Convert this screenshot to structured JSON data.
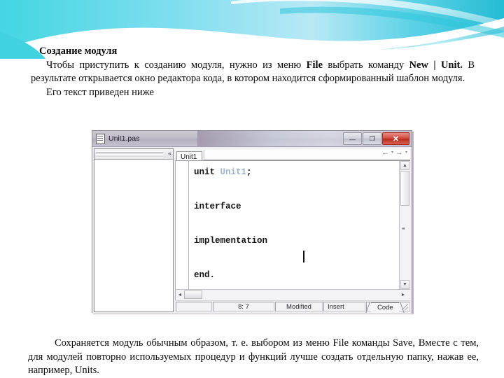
{
  "slide": {
    "heading": "Создание модуля",
    "paragraph_1_line1": "Чтобы приступить к созданию модуля, нужно из меню ",
    "paragraph_1_bold_file": "File",
    "paragraph_1_line1b": " выбрать команду ",
    "paragraph_1_bold_new": "New | Unit.",
    "paragraph_1_rest": " В результате открывается окно редактора кода, в котором находится сформированный шаблон модуля.",
    "paragraph_2": "Его текст приведен ниже",
    "paragraph_bottom_a": "Сохраняется модуль обычным образом, т. е. выбором из меню ",
    "paragraph_bottom_file": "File",
    "paragraph_bottom_b": " команды Save, Вместе с тем, для модулей повторно используемых процедур и функций лучше создать отдельную папку, нажав ее, например, Units."
  },
  "ide": {
    "title": "Unit1.pas",
    "window_buttons": {
      "minimize": "—",
      "maximize": "❐",
      "close": "✕"
    },
    "left_panel": {
      "pin_icon": "«"
    },
    "tab": {
      "label": "Unit1"
    },
    "tab_nav": {
      "back": "←",
      "back_caret": "▾",
      "forward": "→",
      "forward_caret": "▾"
    },
    "code": {
      "line1_prefix": "unit ",
      "line1_name": "Unit1",
      "line1_suffix": ";",
      "line2": "",
      "line3": "interface",
      "line4": "",
      "line5": "implementation",
      "line6": "",
      "line7": "end."
    },
    "scrollbars": {
      "up": "▲",
      "down": "▼",
      "left": "◄",
      "right": "►",
      "mark": "≡"
    },
    "status": {
      "position": "8: 7",
      "modified": "Modified",
      "insert": "Insert",
      "code_tab": "Code"
    }
  },
  "colors": {
    "wave_cyan": "#3fd3e0",
    "wave_light": "#bfe9f2",
    "wave_deep": "#1fb7cf",
    "close_red": "#c3352a",
    "code_dim": "#9fb3c9"
  }
}
